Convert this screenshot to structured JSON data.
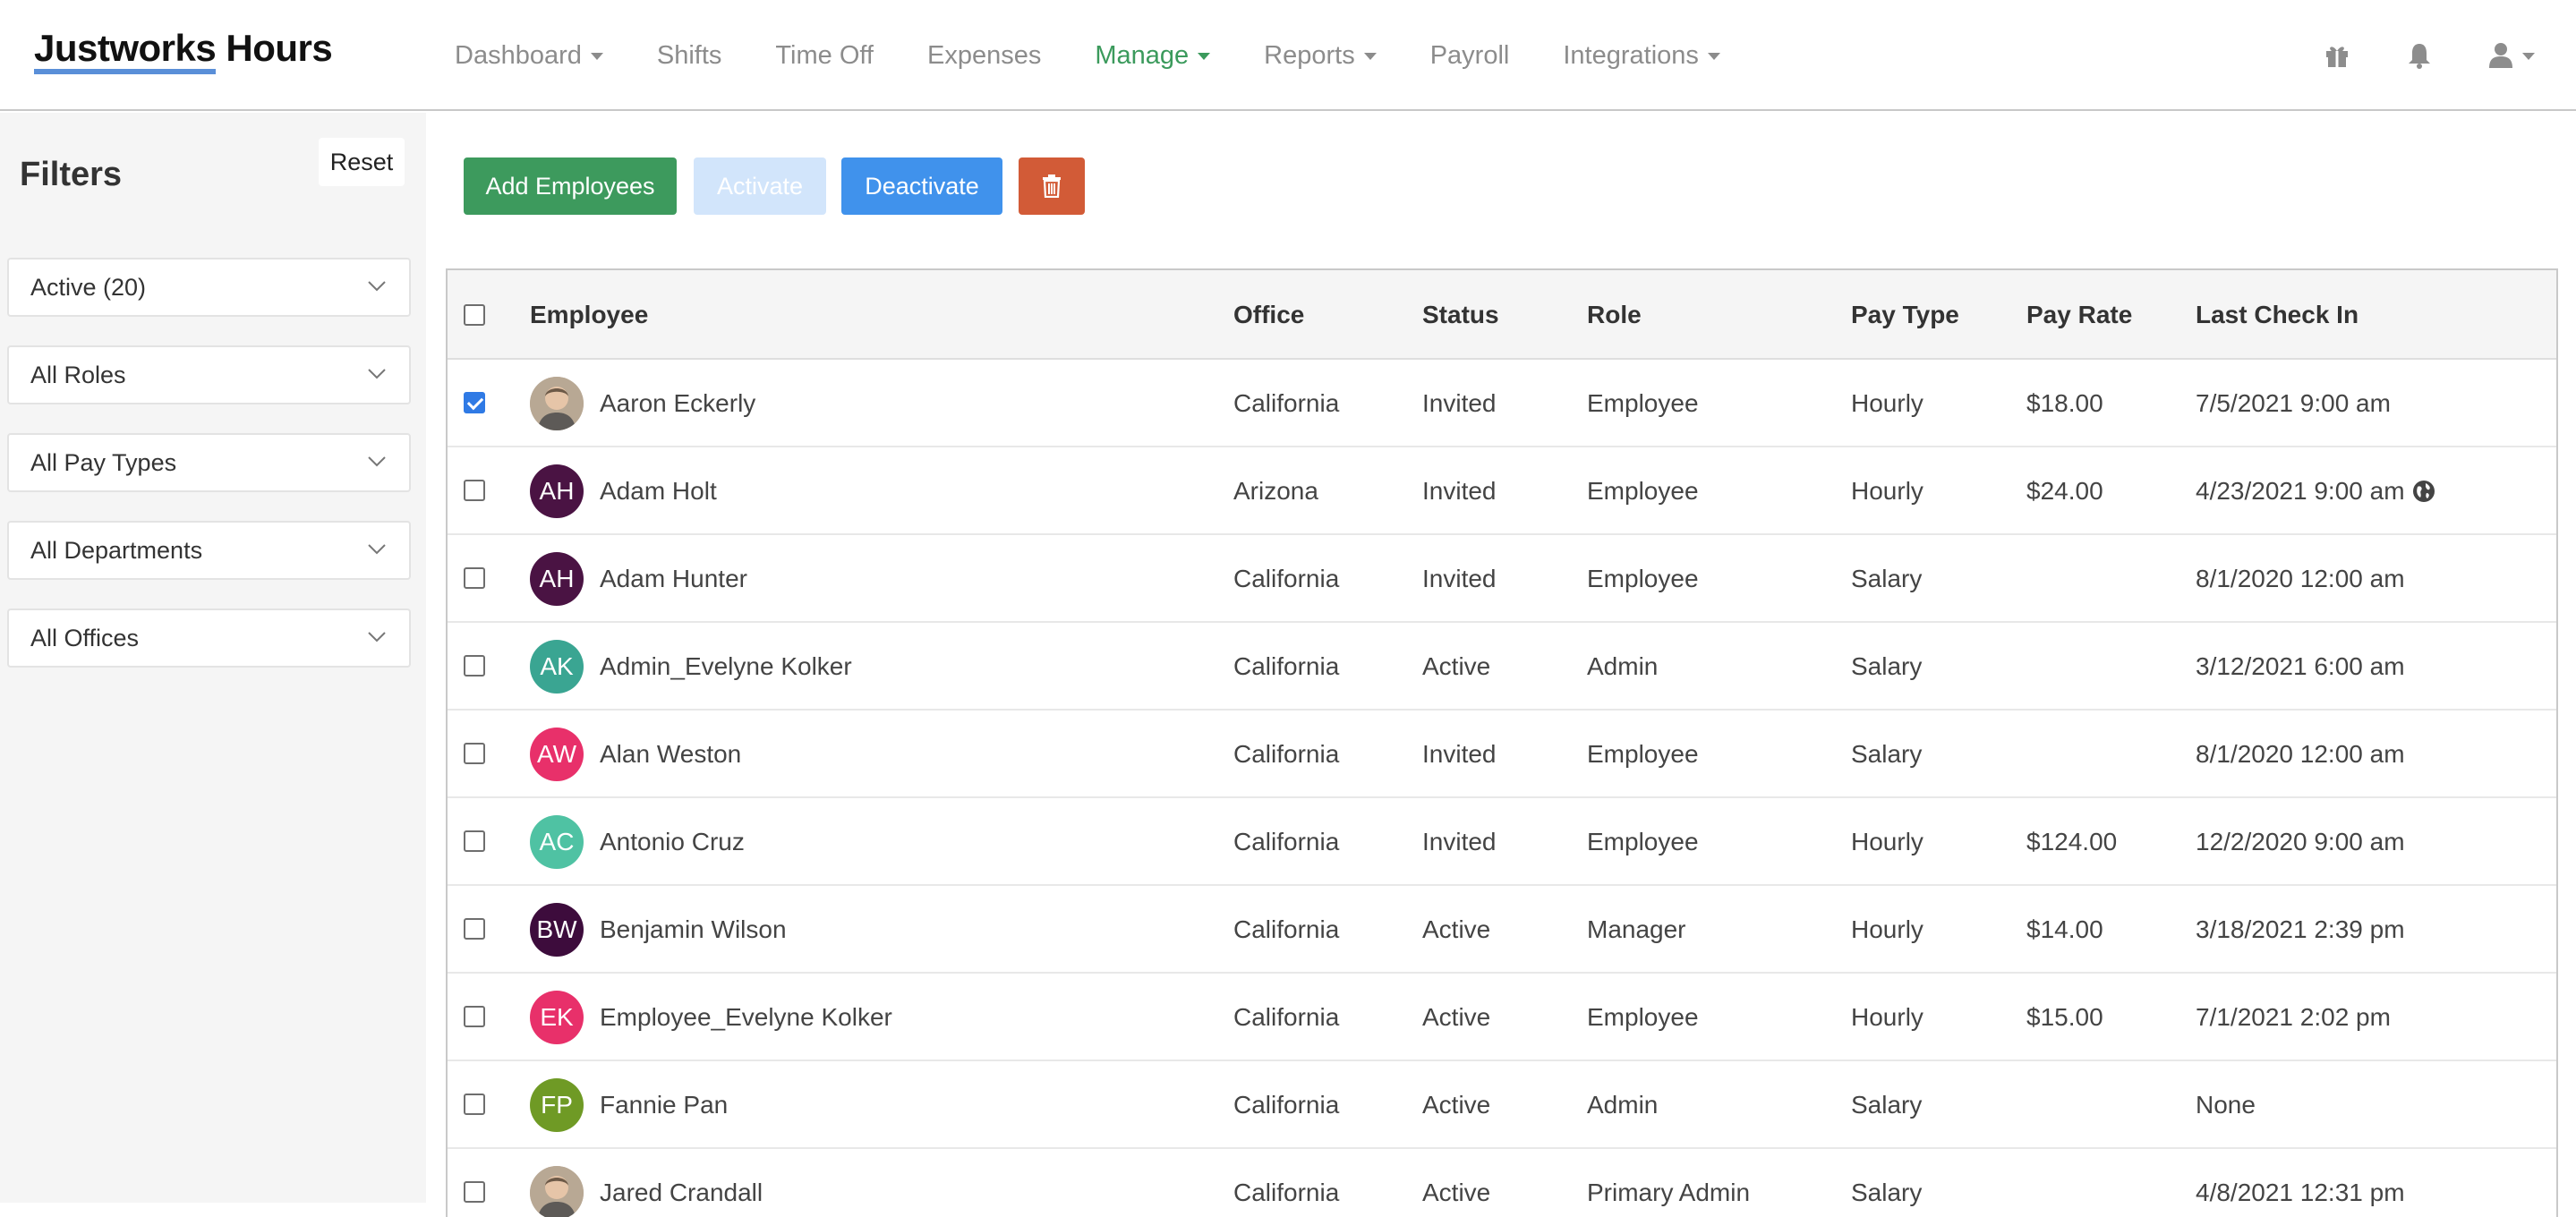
{
  "app": {
    "brand_part1": "Justworks",
    "brand_part2": " Hours"
  },
  "nav": [
    {
      "label": "Dashboard",
      "caret": true,
      "active": false
    },
    {
      "label": "Shifts",
      "caret": false,
      "active": false
    },
    {
      "label": "Time Off",
      "caret": false,
      "active": false
    },
    {
      "label": "Expenses",
      "caret": false,
      "active": false
    },
    {
      "label": "Manage",
      "caret": true,
      "active": true
    },
    {
      "label": "Reports",
      "caret": true,
      "active": false
    },
    {
      "label": "Payroll",
      "caret": false,
      "active": false
    },
    {
      "label": "Integrations",
      "caret": true,
      "active": false
    }
  ],
  "top_icons": [
    "gift-icon",
    "bell-icon",
    "user-icon"
  ],
  "sidebar": {
    "title": "Filters",
    "reset_label": "Reset",
    "filters": [
      "Active (20)",
      "All Roles",
      "All Pay Types",
      "All Departments",
      "All Offices"
    ]
  },
  "actions": {
    "add_label": "Add Employees",
    "activate_label": "Activate",
    "deactivate_label": "Deactivate",
    "delete_icon": "trash-icon"
  },
  "colors": {
    "accent_green": "#3d9a5d",
    "activate_disabled": "#d2e5fb",
    "deactivate_blue": "#4092ec",
    "delete_red": "#d25b37"
  },
  "table": {
    "headers": {
      "employee": "Employee",
      "office": "Office",
      "status": "Status",
      "role": "Role",
      "pay_type": "Pay Type",
      "pay_rate": "Pay Rate",
      "last_check_in": "Last Check In"
    },
    "rows": [
      {
        "checked": true,
        "initials": "",
        "avatar_color": "photo",
        "name": "Aaron Eckerly",
        "office": "California",
        "status": "Invited",
        "role": "Employee",
        "pay_type": "Hourly",
        "pay_rate": "$18.00",
        "last_check_in": "7/5/2021 9:00 am",
        "globe": false
      },
      {
        "checked": false,
        "initials": "AH",
        "avatar_color": "#4a1343",
        "name": "Adam Holt",
        "office": "Arizona",
        "status": "Invited",
        "role": "Employee",
        "pay_type": "Hourly",
        "pay_rate": "$24.00",
        "last_check_in": "4/23/2021 9:00 am",
        "globe": true
      },
      {
        "checked": false,
        "initials": "AH",
        "avatar_color": "#4a1343",
        "name": "Adam Hunter",
        "office": "California",
        "status": "Invited",
        "role": "Employee",
        "pay_type": "Salary",
        "pay_rate": "",
        "last_check_in": "8/1/2020 12:00 am",
        "globe": false
      },
      {
        "checked": false,
        "initials": "AK",
        "avatar_color": "#3aa592",
        "name": "Admin_Evelyne Kolker",
        "office": "California",
        "status": "Active",
        "role": "Admin",
        "pay_type": "Salary",
        "pay_rate": "",
        "last_check_in": "3/12/2021 6:00 am",
        "globe": false
      },
      {
        "checked": false,
        "initials": "AW",
        "avatar_color": "#e8306a",
        "name": "Alan Weston",
        "office": "California",
        "status": "Invited",
        "role": "Employee",
        "pay_type": "Salary",
        "pay_rate": "",
        "last_check_in": "8/1/2020 12:00 am",
        "globe": false
      },
      {
        "checked": false,
        "initials": "AC",
        "avatar_color": "#4fc2a3",
        "name": "Antonio Cruz",
        "office": "California",
        "status": "Invited",
        "role": "Employee",
        "pay_type": "Hourly",
        "pay_rate": "$124.00",
        "last_check_in": "12/2/2020 9:00 am",
        "globe": false
      },
      {
        "checked": false,
        "initials": "BW",
        "avatar_color": "#3d0c3c",
        "name": "Benjamin Wilson",
        "office": "California",
        "status": "Active",
        "role": "Manager",
        "pay_type": "Hourly",
        "pay_rate": "$14.00",
        "last_check_in": "3/18/2021 2:39 pm",
        "globe": false
      },
      {
        "checked": false,
        "initials": "EK",
        "avatar_color": "#e8306a",
        "name": "Employee_Evelyne Kolker",
        "office": "California",
        "status": "Active",
        "role": "Employee",
        "pay_type": "Hourly",
        "pay_rate": "$15.00",
        "last_check_in": "7/1/2021 2:02 pm",
        "globe": false
      },
      {
        "checked": false,
        "initials": "FP",
        "avatar_color": "#6f9a25",
        "name": "Fannie Pan",
        "office": "California",
        "status": "Active",
        "role": "Admin",
        "pay_type": "Salary",
        "pay_rate": "",
        "last_check_in": "None",
        "globe": false
      },
      {
        "checked": false,
        "initials": "",
        "avatar_color": "photo",
        "name": "Jared Crandall",
        "office": "California",
        "status": "Active",
        "role": "Primary Admin",
        "pay_type": "Salary",
        "pay_rate": "",
        "last_check_in": "4/8/2021 12:31 pm",
        "globe": false
      }
    ]
  }
}
